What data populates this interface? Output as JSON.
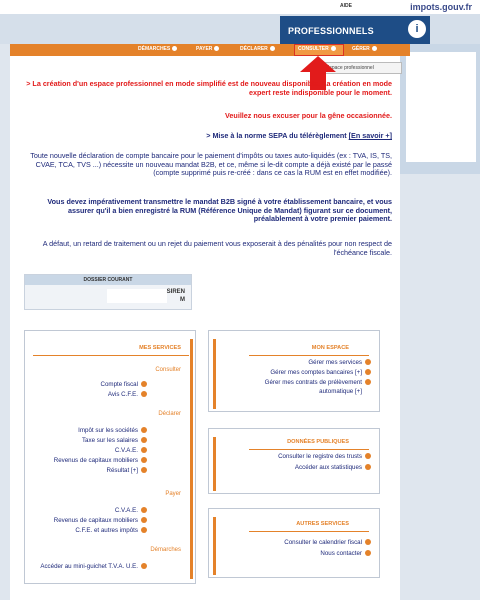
{
  "topbar": {
    "url": "impots.gouv.fr",
    "aide": "AIDE"
  },
  "header": {
    "title": "PROFESSIONNELS",
    "logo_letter": "i"
  },
  "nav": {
    "items": [
      {
        "label": "GÉRER"
      },
      {
        "label": "CONSULTER"
      },
      {
        "label": "DÉCLARER"
      },
      {
        "label": "PAYER"
      },
      {
        "label": "DÉMARCHES"
      }
    ]
  },
  "subtab": {
    "label": "Espace professionnel"
  },
  "content": {
    "p1": "> La création d'un espace professionnel en mode simplifié est de nouveau disponible. La création en mode expert reste indisponible pour le moment.",
    "p2": "Veuillez nous excuser pour la gêne occasionnée.",
    "p3_prefix": "> Mise à la norme SEPA du télérèglement ",
    "p3_link": "[En savoir +]",
    "p4": "Toute nouvelle déclaration de compte bancaire pour le paiement d'impôts ou taxes auto-liquidés (ex : TVA, IS, TS, CVAE, TCA, TVS ...) nécessite un nouveau mandat B2B, et ce, même si le-dit compte a déjà existé par le passé (compte supprimé puis re-créé : dans ce cas la RUM est en effet modifiée).",
    "p5": "Vous devez impérativement transmettre le mandat B2B signé à votre établissement bancaire, et vous assurer qu'il a bien enregistré la RUM (Référence Unique de Mandat) figurant sur ce document, préalablement à votre premier paiement.",
    "p6": "A défaut, un retard de traitement ou un rejet du paiement vous exposerait à des pénalités pour non respect de l'échéance fiscale."
  },
  "dossier": {
    "title": "DOSSIER COURANT",
    "siren_label": "SIREN",
    "m_label": "M"
  },
  "mon_espace": {
    "title": "MON ESPACE",
    "items": [
      "Gérer mes services",
      "Gérer mes comptes bancaires [+]",
      "Gérer mes contrats de prélèvement",
      "automatique [+]"
    ]
  },
  "donnees_publiques": {
    "title": "DONNÉES PUBLIQUES",
    "items": [
      "Consulter le registre des trusts",
      "Accéder aux statistiques"
    ]
  },
  "autres_services": {
    "title": "AUTRES SERVICES",
    "items": [
      "Consulter le calendrier fiscal",
      "Nous contacter"
    ]
  },
  "mes_services": {
    "title": "MES SERVICES",
    "consulter_head": "Consulter",
    "consulter": [
      "Compte fiscal",
      "Avis C.F.E."
    ],
    "declarer_head": "Déclarer",
    "declarer": [
      "Impôt sur les sociétés",
      "Taxe sur les salaires",
      "C.V.A.E.",
      "Revenus de capitaux mobiliers",
      "Résultat [+]"
    ],
    "payer_head": "Payer",
    "payer": [
      "C.V.A.E.",
      "Revenus de capitaux mobiliers",
      "C.F.E. et autres impôts"
    ],
    "demarches_head": "Démarches",
    "demarches": [
      "Accéder au mini-guichet T.V.A. U.E."
    ]
  },
  "colors": {
    "accent": "#e4822a",
    "brand": "#1e4d86",
    "alert": "#e21b1b"
  }
}
